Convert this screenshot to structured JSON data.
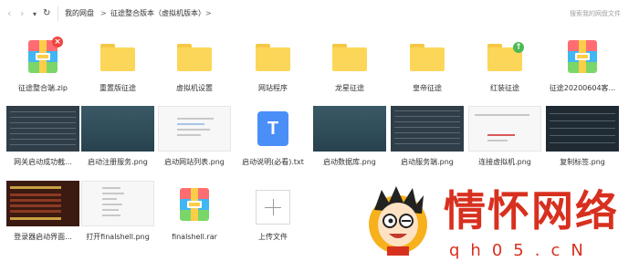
{
  "toolbar": {
    "back": "‹",
    "forward": "›",
    "history": "▾",
    "refresh": "↻",
    "search_placeholder": "搜索我的网盘文件"
  },
  "breadcrumb": {
    "root": "我的网盘",
    "current": "征途整合版本（虚拟机版本）",
    "arrow": ">"
  },
  "items": [
    {
      "label": "征途整合端.zip",
      "icon": "archive"
    },
    {
      "label": "重置版征途",
      "icon": "folder"
    },
    {
      "label": "虚拟机设置",
      "icon": "folder"
    },
    {
      "label": "网站程序",
      "icon": "folder"
    },
    {
      "label": "龙星征途",
      "icon": "folder"
    },
    {
      "label": "皇帝征途",
      "icon": "folder"
    },
    {
      "label": "红装征途",
      "icon": "folder"
    },
    {
      "label": "征途20200604客...",
      "icon": "archive"
    },
    {
      "label": "网关启动成功截...",
      "icon": "screenshot"
    },
    {
      "label": "启动注册服务.png",
      "icon": "screenshot"
    },
    {
      "label": "启动网站列表.png",
      "icon": "screenshot"
    },
    {
      "label": "启动说明(必看).txt",
      "icon": "txt"
    },
    {
      "label": "启动数据库.png",
      "icon": "screenshot"
    },
    {
      "label": "启动服务端.png",
      "icon": "screenshot"
    },
    {
      "label": "连接虚拟机.png",
      "icon": "screenshot"
    },
    {
      "label": "复制标签.png",
      "icon": "screenshot"
    },
    {
      "label": "登录器启动界面...",
      "icon": "screenshot"
    },
    {
      "label": "打开finalshell.png",
      "icon": "screenshot"
    },
    {
      "label": "finalshell.rar",
      "icon": "archive"
    },
    {
      "label": "上传文件",
      "icon": "plus-icon"
    }
  ],
  "badges": {
    "delete": "×",
    "upload": "↑"
  },
  "txt_letter": "T",
  "watermark": {
    "text": "情怀网络",
    "url": "qh05.cN"
  }
}
